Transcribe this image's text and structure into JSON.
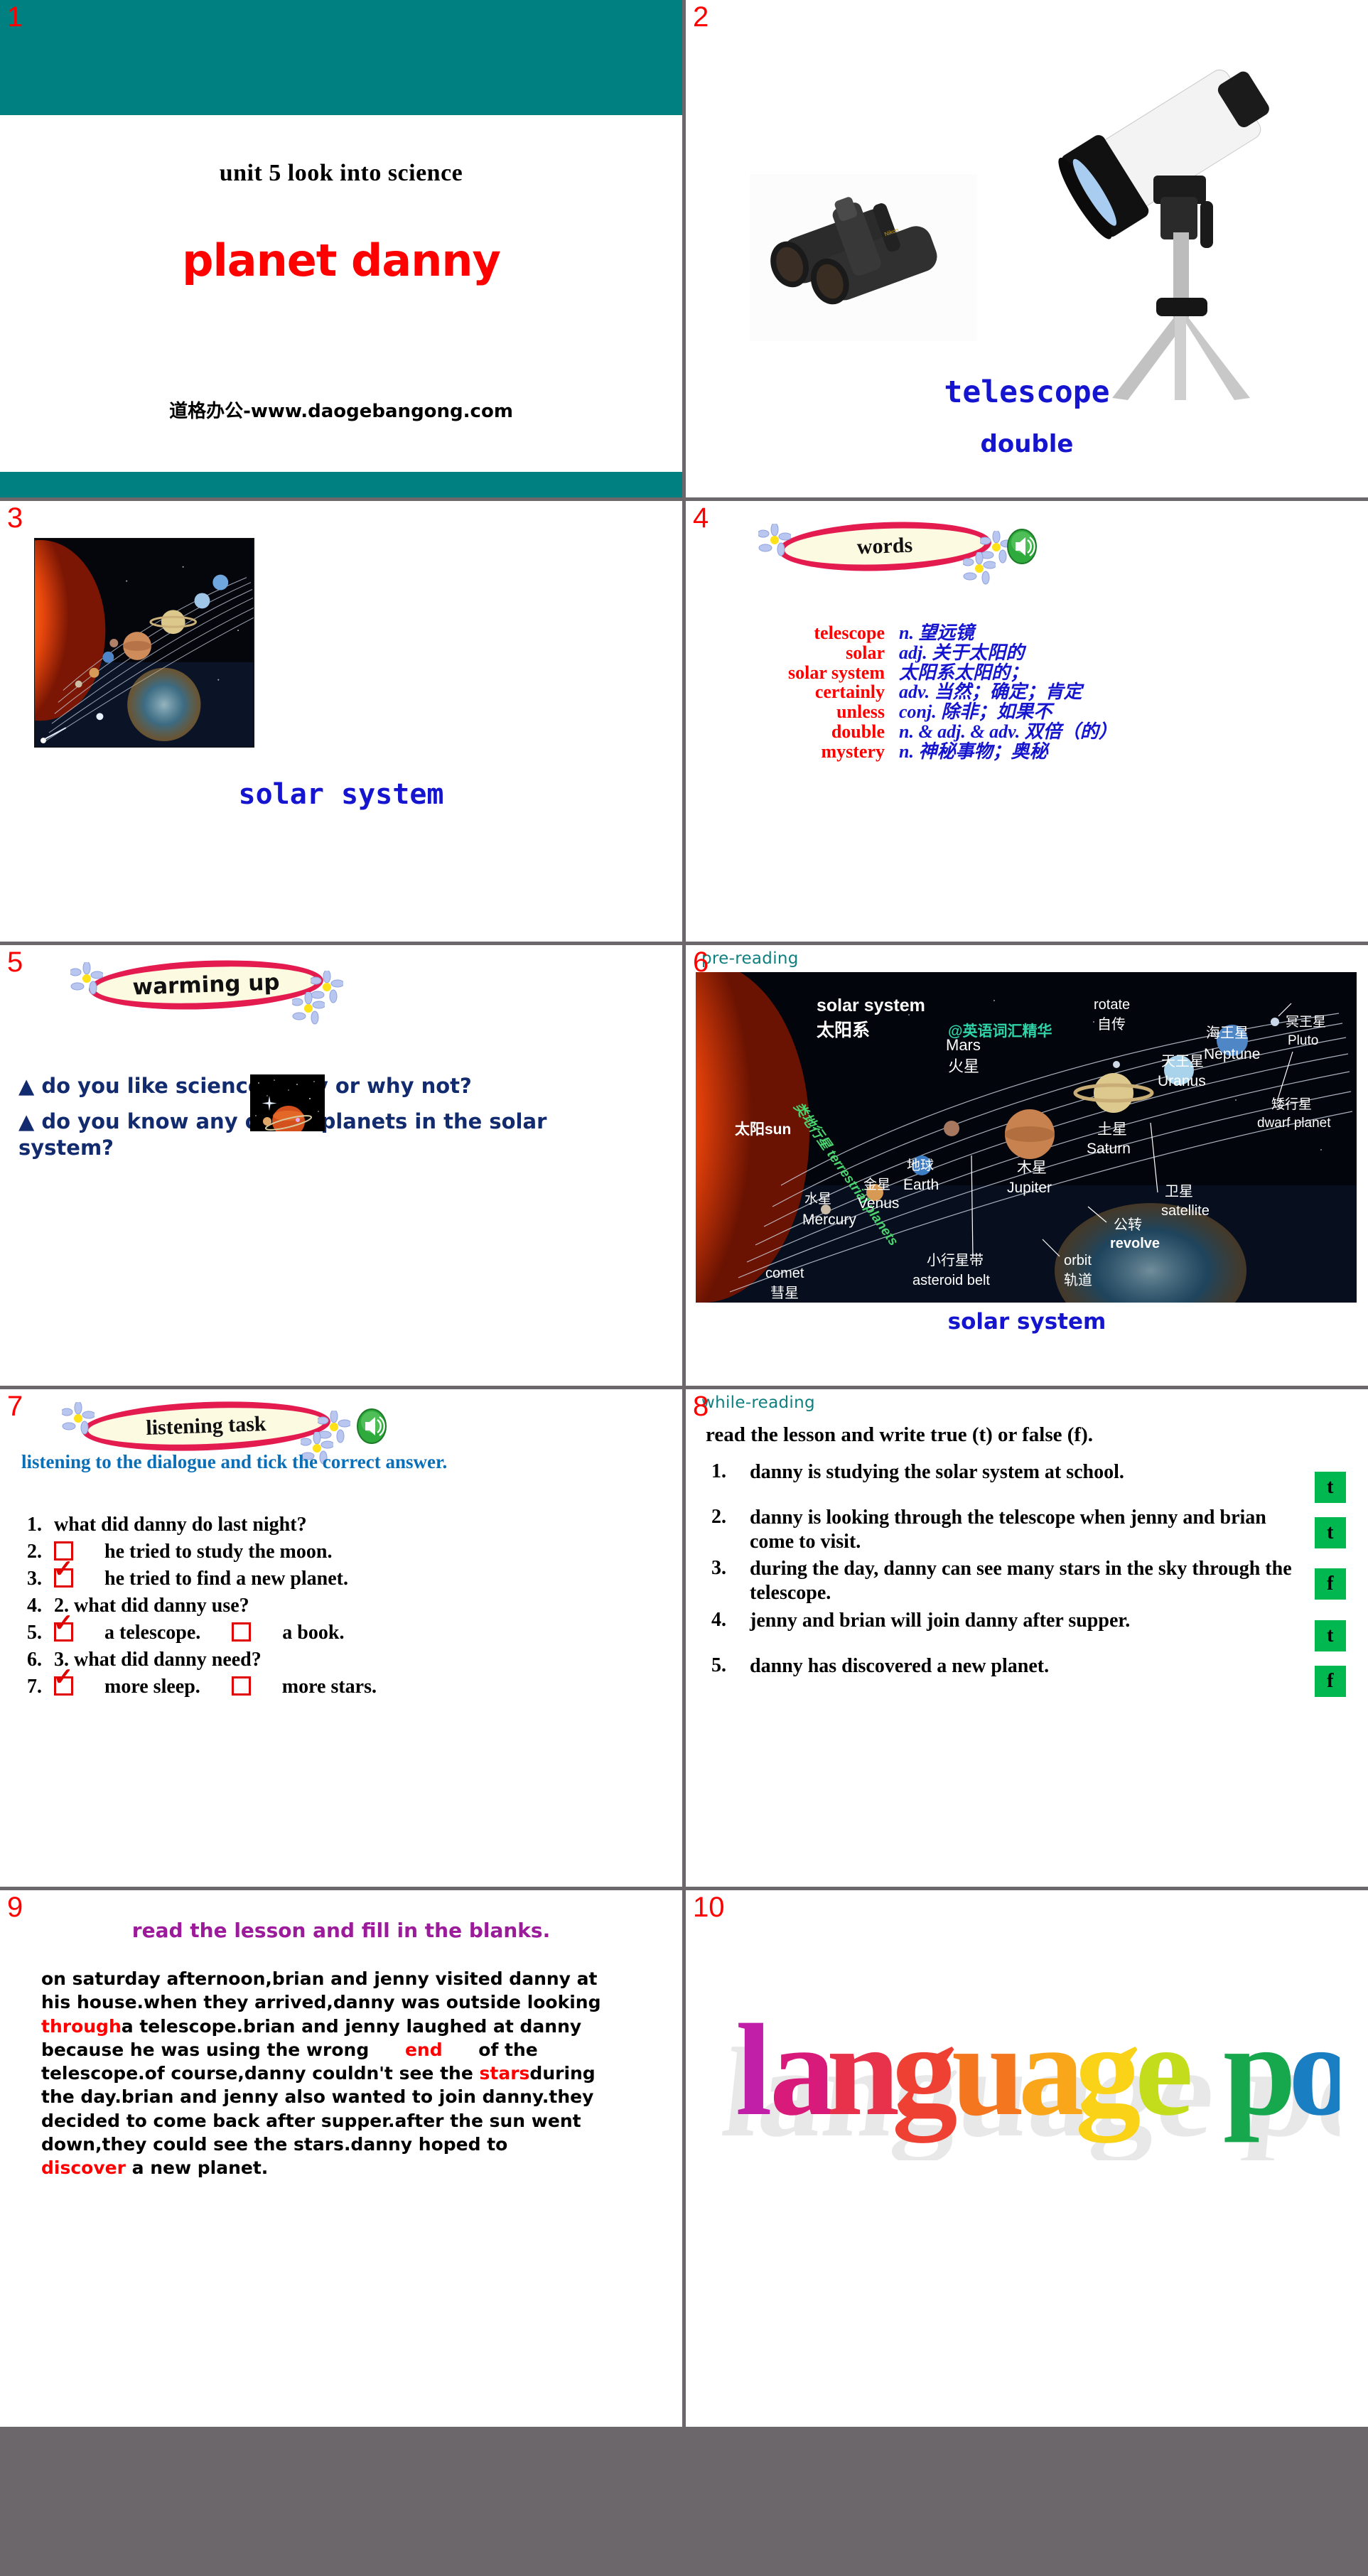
{
  "deck": {
    "slide_numbers": [
      "1",
      "2",
      "3",
      "4",
      "5",
      "6",
      "7",
      "8",
      "9",
      "10"
    ]
  },
  "slide1": {
    "number": "1",
    "unit_line": "unit  5  look into science",
    "title": "planet danny",
    "website": "道格办公-www.daogebangong.com",
    "header_color": "#008080"
  },
  "slide2": {
    "number": "2",
    "caption_main": "telescope",
    "caption_sub": "double",
    "caption_color": "#1515cf",
    "images": [
      "binoculars-photo",
      "telescope-photo"
    ]
  },
  "slide3": {
    "number": "3",
    "caption": "solar system",
    "image": "solar-system-photo"
  },
  "slide4": {
    "number": "4",
    "banner": "words",
    "speaker_icon": "speaker-icon",
    "words": [
      {
        "en": "telescope",
        "cn": "n. 望远镜"
      },
      {
        "en": "solar",
        "cn": "adj. 关于太阳的"
      },
      {
        "en": "solar system",
        "cn": "太阳系太阳的；"
      },
      {
        "en": "certainly",
        "cn": "adv. 当然；确定；肯定"
      },
      {
        "en": "unless",
        "cn": "conj. 除非；如果不"
      },
      {
        "en": "double",
        "cn": "n. & adj. & adv. 双倍（的）"
      },
      {
        "en": "mystery",
        "cn": "n. 神秘事物；奥秘"
      }
    ],
    "en_color": "#ff0000",
    "cn_color": "#1515cf"
  },
  "slide5": {
    "number": "5",
    "banner": "warming up",
    "questions": [
      "▲ do you like science? why or why not?",
      "▲ do you know any of the planets in the solar system?"
    ],
    "image": "ringed-planet-photo"
  },
  "slide6": {
    "number": "6",
    "section": "pre-reading",
    "caption": "solar system",
    "diagram": {
      "title_en": "solar system",
      "title_cn": "太阳系",
      "watermark": "@英语词汇精华",
      "labels": [
        {
          "cn": "太阳",
          "en": "sun"
        },
        {
          "cn": "类地行星",
          "en": "terrestrial planets"
        },
        {
          "cn": "水星",
          "en": "Mercury"
        },
        {
          "cn": "金星",
          "en": "Venus"
        },
        {
          "cn": "地球",
          "en": "Earth"
        },
        {
          "cn": "火星",
          "en": "Mars"
        },
        {
          "cn": "木星",
          "en": "Jupiter"
        },
        {
          "cn": "土星",
          "en": "Saturn"
        },
        {
          "cn": "天王星",
          "en": "Uranus"
        },
        {
          "cn": "海王星",
          "en": "Neptune"
        },
        {
          "cn": "冥王星",
          "en": "Pluto"
        },
        {
          "cn": "矮行星",
          "en": "dwarf planet"
        },
        {
          "cn": "卫星",
          "en": "satellite"
        },
        {
          "cn": "公转",
          "en": "revolve"
        },
        {
          "cn": "自传",
          "en": "rotate"
        },
        {
          "cn": "轨道",
          "en": "orbit"
        },
        {
          "cn": "小行星带",
          "en": "asteroid belt"
        },
        {
          "cn": "彗星",
          "en": "comet"
        }
      ]
    }
  },
  "slide7": {
    "number": "7",
    "banner": "listening  task",
    "speaker_icon": "speaker-icon",
    "subtitle": "listening to the dialogue and tick the correct answer.",
    "lines": [
      {
        "idx": "1.",
        "text": "what did danny do last night?",
        "box": "none"
      },
      {
        "idx": "2.",
        "text": "he tried to study the moon.",
        "box": "empty"
      },
      {
        "idx": "3.",
        "text": "he tried to find a new planet.",
        "box": "ticked"
      },
      {
        "idx": "4.",
        "text": "2. what did danny use?",
        "box": "none"
      },
      {
        "idx": "5.",
        "text": "a telescope.",
        "box": "ticked",
        "text2": "a book.",
        "box2": "empty"
      },
      {
        "idx": "6.",
        "text": "3. what did danny need?",
        "box": "none"
      },
      {
        "idx": "7.",
        "text": "more sleep.",
        "box": "ticked",
        "text2": "more stars.",
        "box2": "empty"
      }
    ]
  },
  "slide8": {
    "number": "8",
    "section": "while-reading",
    "heading": "read the lesson and write true (t) or false (f).",
    "items": [
      {
        "n": "1.",
        "text": "danny is studying the solar system at school.",
        "answer": "t"
      },
      {
        "n": "2.",
        "text": "danny is looking through the telescope when jenny and brian come to visit.",
        "answer": "t"
      },
      {
        "n": "3.",
        "text": "during the day, danny can see many stars in the sky through the telescope.",
        "answer": "f"
      },
      {
        "n": "4.",
        "text": "jenny and brian will join danny after supper.",
        "answer": "t"
      },
      {
        "n": "5.",
        "text": "danny has discovered a new planet.",
        "answer": "f"
      }
    ],
    "answer_bg": "#00b84f"
  },
  "slide9": {
    "number": "9",
    "heading": "read the lesson and fill in the blanks.",
    "paragraph_parts": [
      {
        "t": "  on saturday afternoon,brian and jenny visited danny at his house.when they arrived,danny was outside looking ",
        "k": "plain"
      },
      {
        "t": "through",
        "k": "blank"
      },
      {
        "t": "a telescope.brian and jenny laughed at danny because he was using the wrong ",
        "k": "plain"
      },
      {
        "t": "end",
        "k": "blank"
      },
      {
        "t": " of the telescope.of course,danny couldn't see the ",
        "k": "plain"
      },
      {
        "t": "stars",
        "k": "blank"
      },
      {
        "t": "during the day.brian and jenny also wanted to join danny.they decided to come back after supper.after the sun went down,they could see the stars.danny hoped to ",
        "k": "plain"
      },
      {
        "t": "discover",
        "k": "blank"
      },
      {
        "t": " a new planet.",
        "k": "plain"
      }
    ],
    "heading_color": "#9b1b9b",
    "blank_color": "#ff0000"
  },
  "slide10": {
    "number": "10",
    "title": "language  points",
    "letters": [
      {
        "ch": "l",
        "color": "#c21fa8"
      },
      {
        "ch": "a",
        "color": "#d81b7a"
      },
      {
        "ch": "n",
        "color": "#e8314a"
      },
      {
        "ch": "g",
        "color": "#ef4133"
      },
      {
        "ch": "u",
        "color": "#f4761f"
      },
      {
        "ch": "a",
        "color": "#f9a61a"
      },
      {
        "ch": "g",
        "color": "#fad217"
      },
      {
        "ch": "e",
        "color": "#c3dc1b"
      },
      {
        "ch": " ",
        "color": "#ffffff"
      },
      {
        "ch": "p",
        "color": "#17a74c"
      },
      {
        "ch": "o",
        "color": "#1a7ec2"
      },
      {
        "ch": "i",
        "color": "#1733d6"
      },
      {
        "ch": "n",
        "color": "#3a1fd0"
      },
      {
        "ch": "t",
        "color": "#6c1fc4"
      },
      {
        "ch": "s",
        "color": "#a01fbf"
      }
    ]
  }
}
